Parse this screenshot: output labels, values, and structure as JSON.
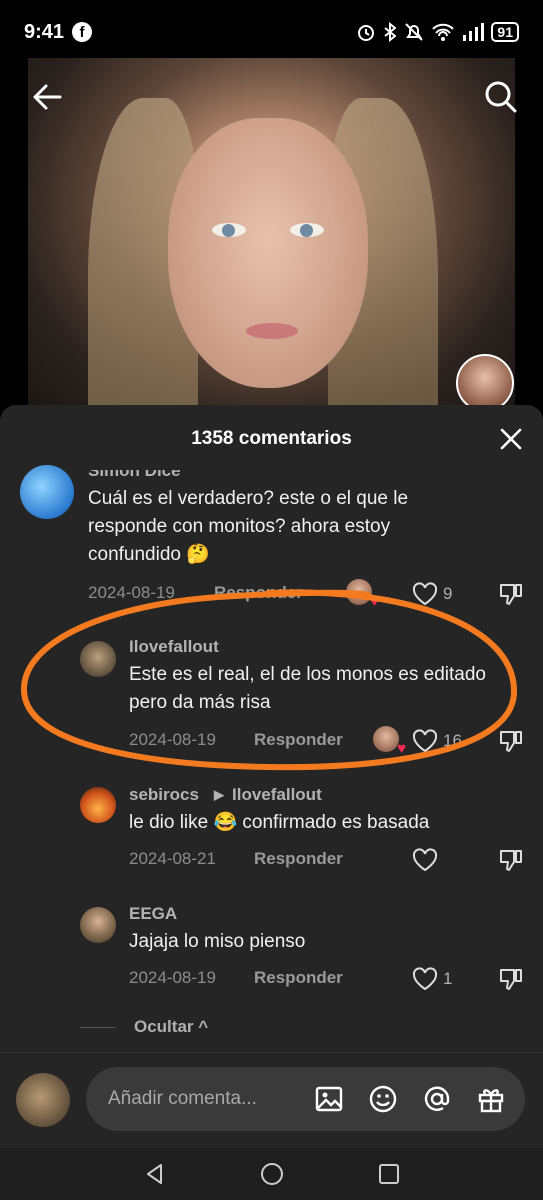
{
  "status_bar": {
    "time": "9:41",
    "facebook_icon": "facebook-icon",
    "battery": "91"
  },
  "comments_sheet": {
    "title": "1358 comentarios",
    "comments": [
      {
        "username": "Simon Dice",
        "text": "Cuál es el verdadero? este o el que le responde con monitos? ahora estoy confundido 🤔",
        "date": "2024-08-19",
        "reply_label": "Responder",
        "likes": "9"
      },
      {
        "username": "Ilovefallout",
        "text": "Este es el real, el de los monos es editado pero da más risa",
        "date": "2024-08-19",
        "reply_label": "Responder",
        "likes": "16"
      },
      {
        "username": "sebirocs",
        "reply_to": "Ilovefallout",
        "text": "le dio like 😂 confirmado es basada",
        "date": "2024-08-21",
        "reply_label": "Responder",
        "likes": ""
      },
      {
        "username": "EEGA",
        "text": "Jajaja lo miso pienso",
        "date": "2024-08-19",
        "reply_label": "Responder",
        "likes": "1"
      }
    ],
    "hide_label": "Ocultar ^"
  },
  "input": {
    "placeholder": "Añadir comenta..."
  },
  "colors": {
    "sheet_bg": "#252525",
    "highlight": "#f47a20",
    "like_red": "#fe2c55"
  }
}
